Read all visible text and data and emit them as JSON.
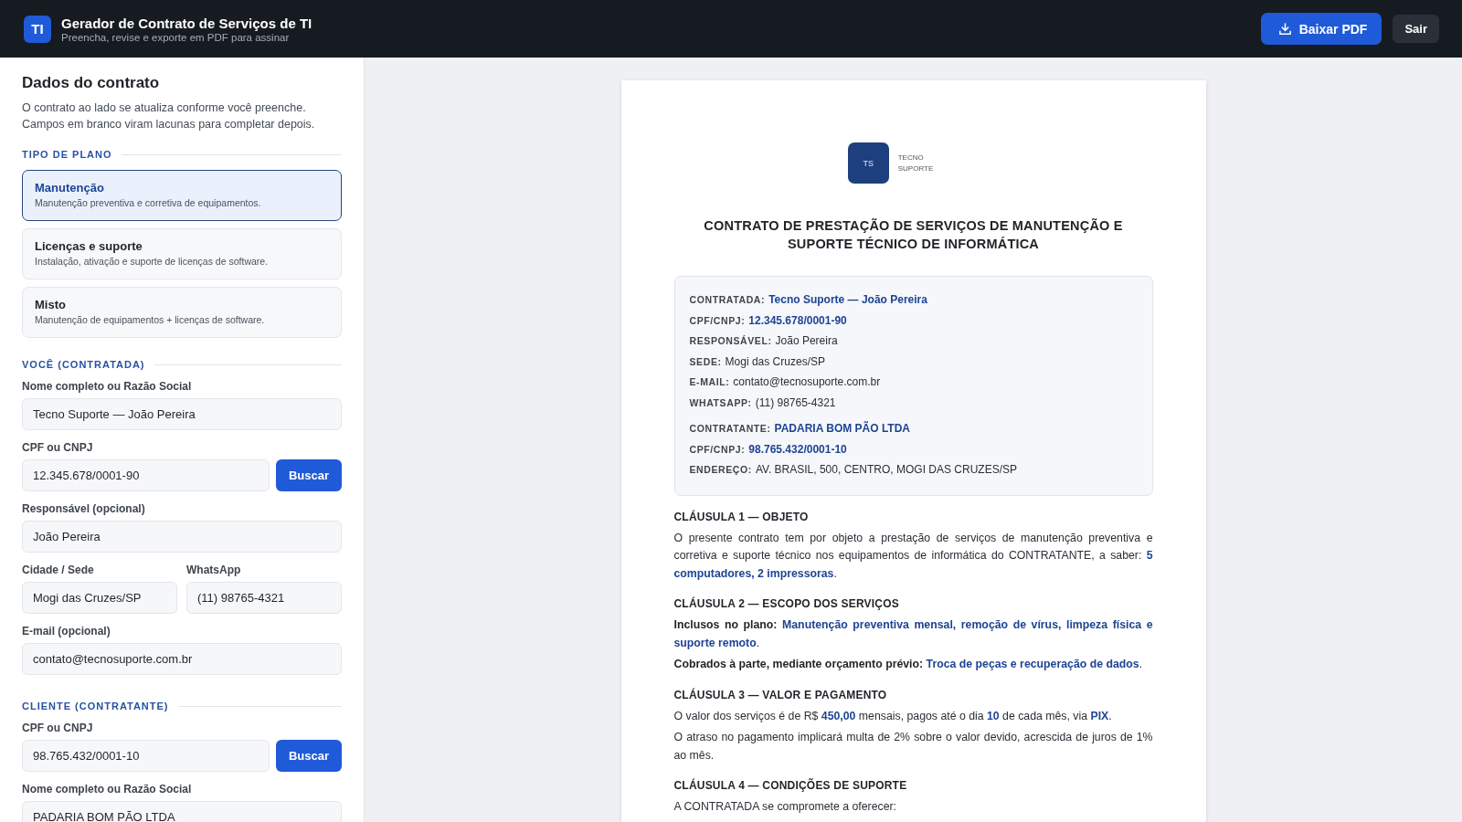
{
  "header": {
    "logo": "TI",
    "title": "Gerador de Contrato de Serviços de TI",
    "subtitle": "Preencha, revise e exporte em PDF para assinar",
    "buttons": [
      {
        "label": "Baixar PDF",
        "kind": "primary"
      },
      {
        "label": "Sair",
        "kind": "secondary"
      }
    ]
  },
  "form": {
    "title": "Dados do contrato",
    "description": [
      "O contrato ao lado se atualiza conforme você preenche.",
      "Campos em branco viram lacunas para completar depois."
    ],
    "sections": [
      {
        "heading": "TIPO DE PLANO",
        "kind": "plans",
        "plans": [
          {
            "name": "Manutenção",
            "description": "Manutenção preventiva e corretiva de equipamentos.",
            "selected": true
          },
          {
            "name": "Licenças e suporte",
            "description": "Instalação, ativação e suporte de licenças de software.",
            "selected": false
          },
          {
            "name": "Misto",
            "description": "Manutenção de equipamentos + licenças de software.",
            "selected": false
          }
        ]
      },
      {
        "heading": "VOCÊ (CONTRATADA)",
        "kind": "fields",
        "rows": [
          [
            {
              "label": "Nome completo ou Razão Social",
              "value": "Tecno Suporte — João Pereira"
            }
          ],
          [
            {
              "label": "CPF ou CNPJ",
              "value": "12.345.678/0001-90",
              "button": "Buscar"
            }
          ],
          [
            {
              "label": "Responsável (opcional)",
              "value": "João Pereira"
            }
          ],
          [
            {
              "label": "Cidade / Sede",
              "value": "Mogi das Cruzes/SP"
            },
            {
              "label": "WhatsApp",
              "value": "(11) 98765-4321"
            }
          ],
          [
            {
              "label": "E-mail (opcional)",
              "value": "contato@tecnosuporte.com.br"
            }
          ]
        ]
      },
      {
        "heading": "CLIENTE (CONTRATANTE)",
        "kind": "fields",
        "rows": [
          [
            {
              "label": "CPF ou CNPJ",
              "value": "98.765.432/0001-10",
              "button": "Buscar"
            }
          ],
          [
            {
              "label": "Nome completo ou Razão Social",
              "value": "PADARIA BOM PÃO LTDA"
            }
          ]
        ]
      }
    ]
  },
  "document": {
    "logo": {
      "mark": "TS",
      "lines": [
        "TECNO",
        "SUPORTE"
      ]
    },
    "title": "CONTRATO DE PRESTAÇÃO DE SERVIÇOS DE MANUTENÇÃO E SUPORTE TÉCNICO DE INFORMÁTICA",
    "parties": [
      [
        {
          "label": "CONTRATADA:",
          "value": "Tecno Suporte — João Pereira",
          "highlight": true
        },
        {
          "label": "CPF/CNPJ:",
          "value": "12.345.678/0001-90",
          "highlight": true
        },
        {
          "label": "RESPONSÁVEL:",
          "value": "João Pereira",
          "highlight": false
        },
        {
          "label": "SEDE:",
          "value": "Mogi das Cruzes/SP",
          "highlight": false
        },
        {
          "label": "E-MAIL:",
          "value": "contato@tecnosuporte.com.br",
          "highlight": false
        },
        {
          "label": "WHATSAPP:",
          "value": "(11) 98765-4321",
          "highlight": false
        }
      ],
      [
        {
          "label": "CONTRATANTE:",
          "value": "PADARIA BOM PÃO LTDA",
          "highlight": true
        },
        {
          "label": "CPF/CNPJ:",
          "value": "98.765.432/0001-10",
          "highlight": true
        },
        {
          "label": "ENDEREÇO:",
          "value": "AV. BRASIL, 500, CENTRO, MOGI DAS CRUZES/SP",
          "highlight": false
        }
      ]
    ],
    "clauses": [
      {
        "heading": "CLÁUSULA 1 — OBJETO",
        "paragraphs": [
          {
            "text": "O presente contrato tem por objeto a prestação de serviços de manutenção preventiva e corretiva e suporte técnico nos equipamentos de informática do CONTRATANTE, a saber: **5 computadores, 2 impressoras**."
          }
        ]
      },
      {
        "heading": "CLÁUSULA 2 — ESCOPO DOS SERVIÇOS",
        "paragraphs": [
          {
            "lead": "Inclusos no plano:",
            "text": "**Manutenção preventiva mensal, remoção de vírus, limpeza física e suporte remoto**."
          },
          {
            "lead": "Cobrados à parte, mediante orçamento prévio:",
            "text": "**Troca de peças e recuperação de dados**."
          }
        ]
      },
      {
        "heading": "CLÁUSULA 3 — VALOR E PAGAMENTO",
        "paragraphs": [
          {
            "text": "O valor dos serviços é de R$ **450,00** mensais, pagos até o dia **10** de cada mês, via **PIX**."
          },
          {
            "text": "O atraso no pagamento implicará multa de 2% sobre o valor devido, acrescida de juros de 1% ao mês."
          }
        ]
      },
      {
        "heading": "CLÁUSULA 4 — CONDIÇÕES DE SUPORTE",
        "paragraphs": [
          {
            "text": "A CONTRATADA se compromete a oferecer:"
          }
        ]
      }
    ]
  }
}
